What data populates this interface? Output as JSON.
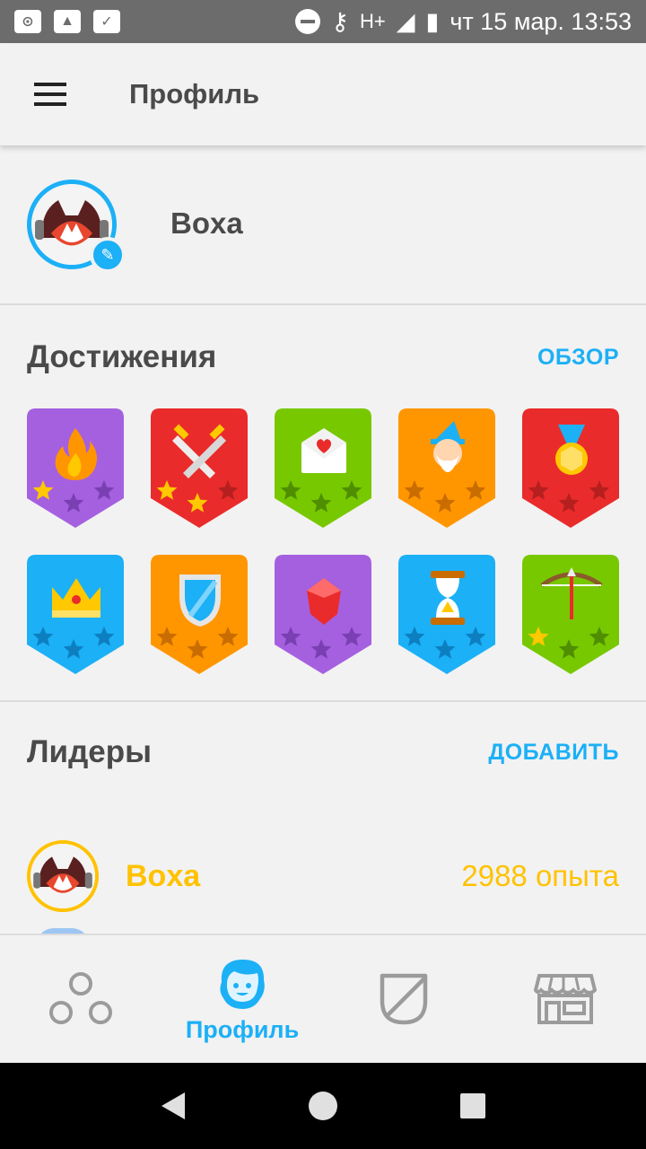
{
  "status_bar": {
    "time_text": "чт 15 мар. 13:53",
    "network": "H+",
    "icons": [
      "vpn-icon",
      "image-icon",
      "check-icon",
      "do-not-disturb-icon",
      "key-icon",
      "signal-icon",
      "battery-icon"
    ]
  },
  "app_bar": {
    "title": "Профиль",
    "menu_icon": "hamburger-menu-icon"
  },
  "profile": {
    "name": "Boxa",
    "edit_icon": "pencil-icon"
  },
  "achievements": {
    "title": "Достижения",
    "link": "ОБЗОР",
    "badges": [
      {
        "name": "fire",
        "bg": "#a560e0",
        "dark": "#7a3fb2",
        "icon": "flame-icon",
        "stars": 1
      },
      {
        "name": "swords",
        "bg": "#ea2b2b",
        "dark": "#b51f1f",
        "icon": "crossed-swords-icon",
        "stars": 2
      },
      {
        "name": "letter",
        "bg": "#78c800",
        "dark": "#4f8e00",
        "icon": "heart-envelope-icon",
        "stars": 0
      },
      {
        "name": "wizard",
        "bg": "#ff9600",
        "dark": "#c96d00",
        "icon": "wizard-icon",
        "stars": 0
      },
      {
        "name": "medal",
        "bg": "#ea2b2b",
        "dark": "#b51f1f",
        "icon": "medal-icon",
        "stars": 0
      },
      {
        "name": "crown",
        "bg": "#1cb0f6",
        "dark": "#0d7fc0",
        "icon": "crown-icon",
        "stars": 0
      },
      {
        "name": "shield",
        "bg": "#ff9600",
        "dark": "#c96d00",
        "icon": "shield-icon",
        "stars": 0
      },
      {
        "name": "gem",
        "bg": "#a560e0",
        "dark": "#7a3fb2",
        "icon": "gem-icon",
        "stars": 0
      },
      {
        "name": "hourglass",
        "bg": "#1cb0f6",
        "dark": "#0d7fc0",
        "icon": "hourglass-icon",
        "stars": 0
      },
      {
        "name": "bow",
        "bg": "#78c800",
        "dark": "#4f8e00",
        "icon": "bow-arrow-icon",
        "stars": 1
      }
    ]
  },
  "leaders": {
    "title": "Лидеры",
    "link": "ДОБАВИТЬ",
    "entries": [
      {
        "name": "Boxa",
        "xp": "2988 опыта"
      }
    ]
  },
  "bottom_nav": {
    "items": [
      {
        "icon": "learn-circles-icon",
        "label": "",
        "active": false
      },
      {
        "icon": "profile-face-icon",
        "label": "Профиль",
        "active": true
      },
      {
        "icon": "shield-league-icon",
        "label": "",
        "active": false
      },
      {
        "icon": "shop-icon",
        "label": "",
        "active": false
      }
    ]
  },
  "colors": {
    "accent": "#1cb0f6",
    "gold": "#ffc200",
    "text": "#4a4a4a"
  }
}
